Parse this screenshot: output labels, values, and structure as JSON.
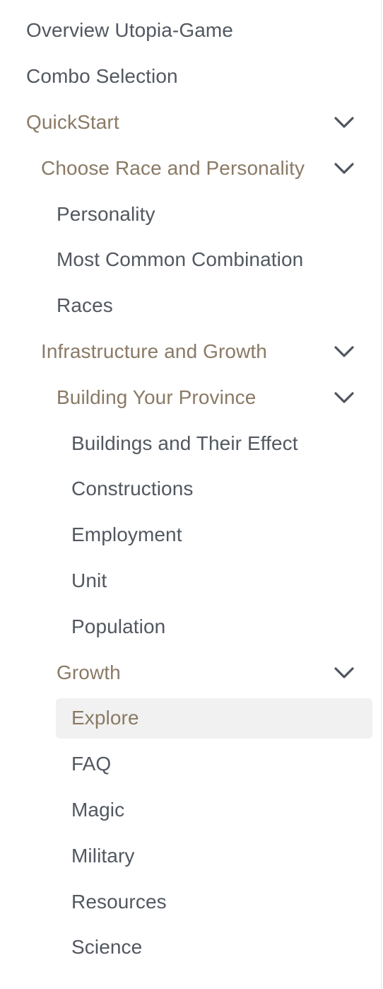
{
  "nav": {
    "items": [
      {
        "label": "Overview Utopia-Game",
        "level": 0,
        "has_children": false,
        "expanded": false,
        "active": false
      },
      {
        "label": "Combo Selection",
        "level": 0,
        "has_children": false,
        "expanded": false,
        "active": false
      },
      {
        "label": "QuickStart",
        "level": 0,
        "has_children": true,
        "expanded": true,
        "active": false
      },
      {
        "label": "Choose Race and Personality",
        "level": 1,
        "has_children": true,
        "expanded": true,
        "active": false
      },
      {
        "label": "Personality",
        "level": 2,
        "has_children": false,
        "expanded": false,
        "active": false
      },
      {
        "label": "Most Common Combination",
        "level": 2,
        "has_children": false,
        "expanded": false,
        "active": false
      },
      {
        "label": "Races",
        "level": 2,
        "has_children": false,
        "expanded": false,
        "active": false
      },
      {
        "label": "Infrastructure and Growth",
        "level": 1,
        "has_children": true,
        "expanded": true,
        "active": false
      },
      {
        "label": "Building Your Province",
        "level": 2,
        "has_children": true,
        "expanded": true,
        "active": false
      },
      {
        "label": "Buildings and Their Effect",
        "level": 3,
        "has_children": false,
        "expanded": false,
        "active": false
      },
      {
        "label": "Constructions",
        "level": 3,
        "has_children": false,
        "expanded": false,
        "active": false
      },
      {
        "label": "Employment",
        "level": 3,
        "has_children": false,
        "expanded": false,
        "active": false
      },
      {
        "label": "Unit",
        "level": 3,
        "has_children": false,
        "expanded": false,
        "active": false
      },
      {
        "label": "Population",
        "level": 3,
        "has_children": false,
        "expanded": false,
        "active": false
      },
      {
        "label": "Growth",
        "level": 2,
        "has_children": true,
        "expanded": true,
        "active": false
      },
      {
        "label": "Explore",
        "level": 3,
        "has_children": false,
        "expanded": false,
        "active": true
      },
      {
        "label": "FAQ",
        "level": 3,
        "has_children": false,
        "expanded": false,
        "active": false
      },
      {
        "label": "Magic",
        "level": 3,
        "has_children": false,
        "expanded": false,
        "active": false
      },
      {
        "label": "Military",
        "level": 3,
        "has_children": false,
        "expanded": false,
        "active": false
      },
      {
        "label": "Resources",
        "level": 3,
        "has_children": false,
        "expanded": false,
        "active": false
      },
      {
        "label": "Science",
        "level": 3,
        "has_children": false,
        "expanded": false,
        "active": false
      }
    ]
  },
  "colors": {
    "text": "#525860",
    "accent": "#8a7a66",
    "active_bg": "#f1f1f1",
    "chevron": "#4f555d"
  },
  "icons": {
    "expand": "chevron-down-icon"
  }
}
